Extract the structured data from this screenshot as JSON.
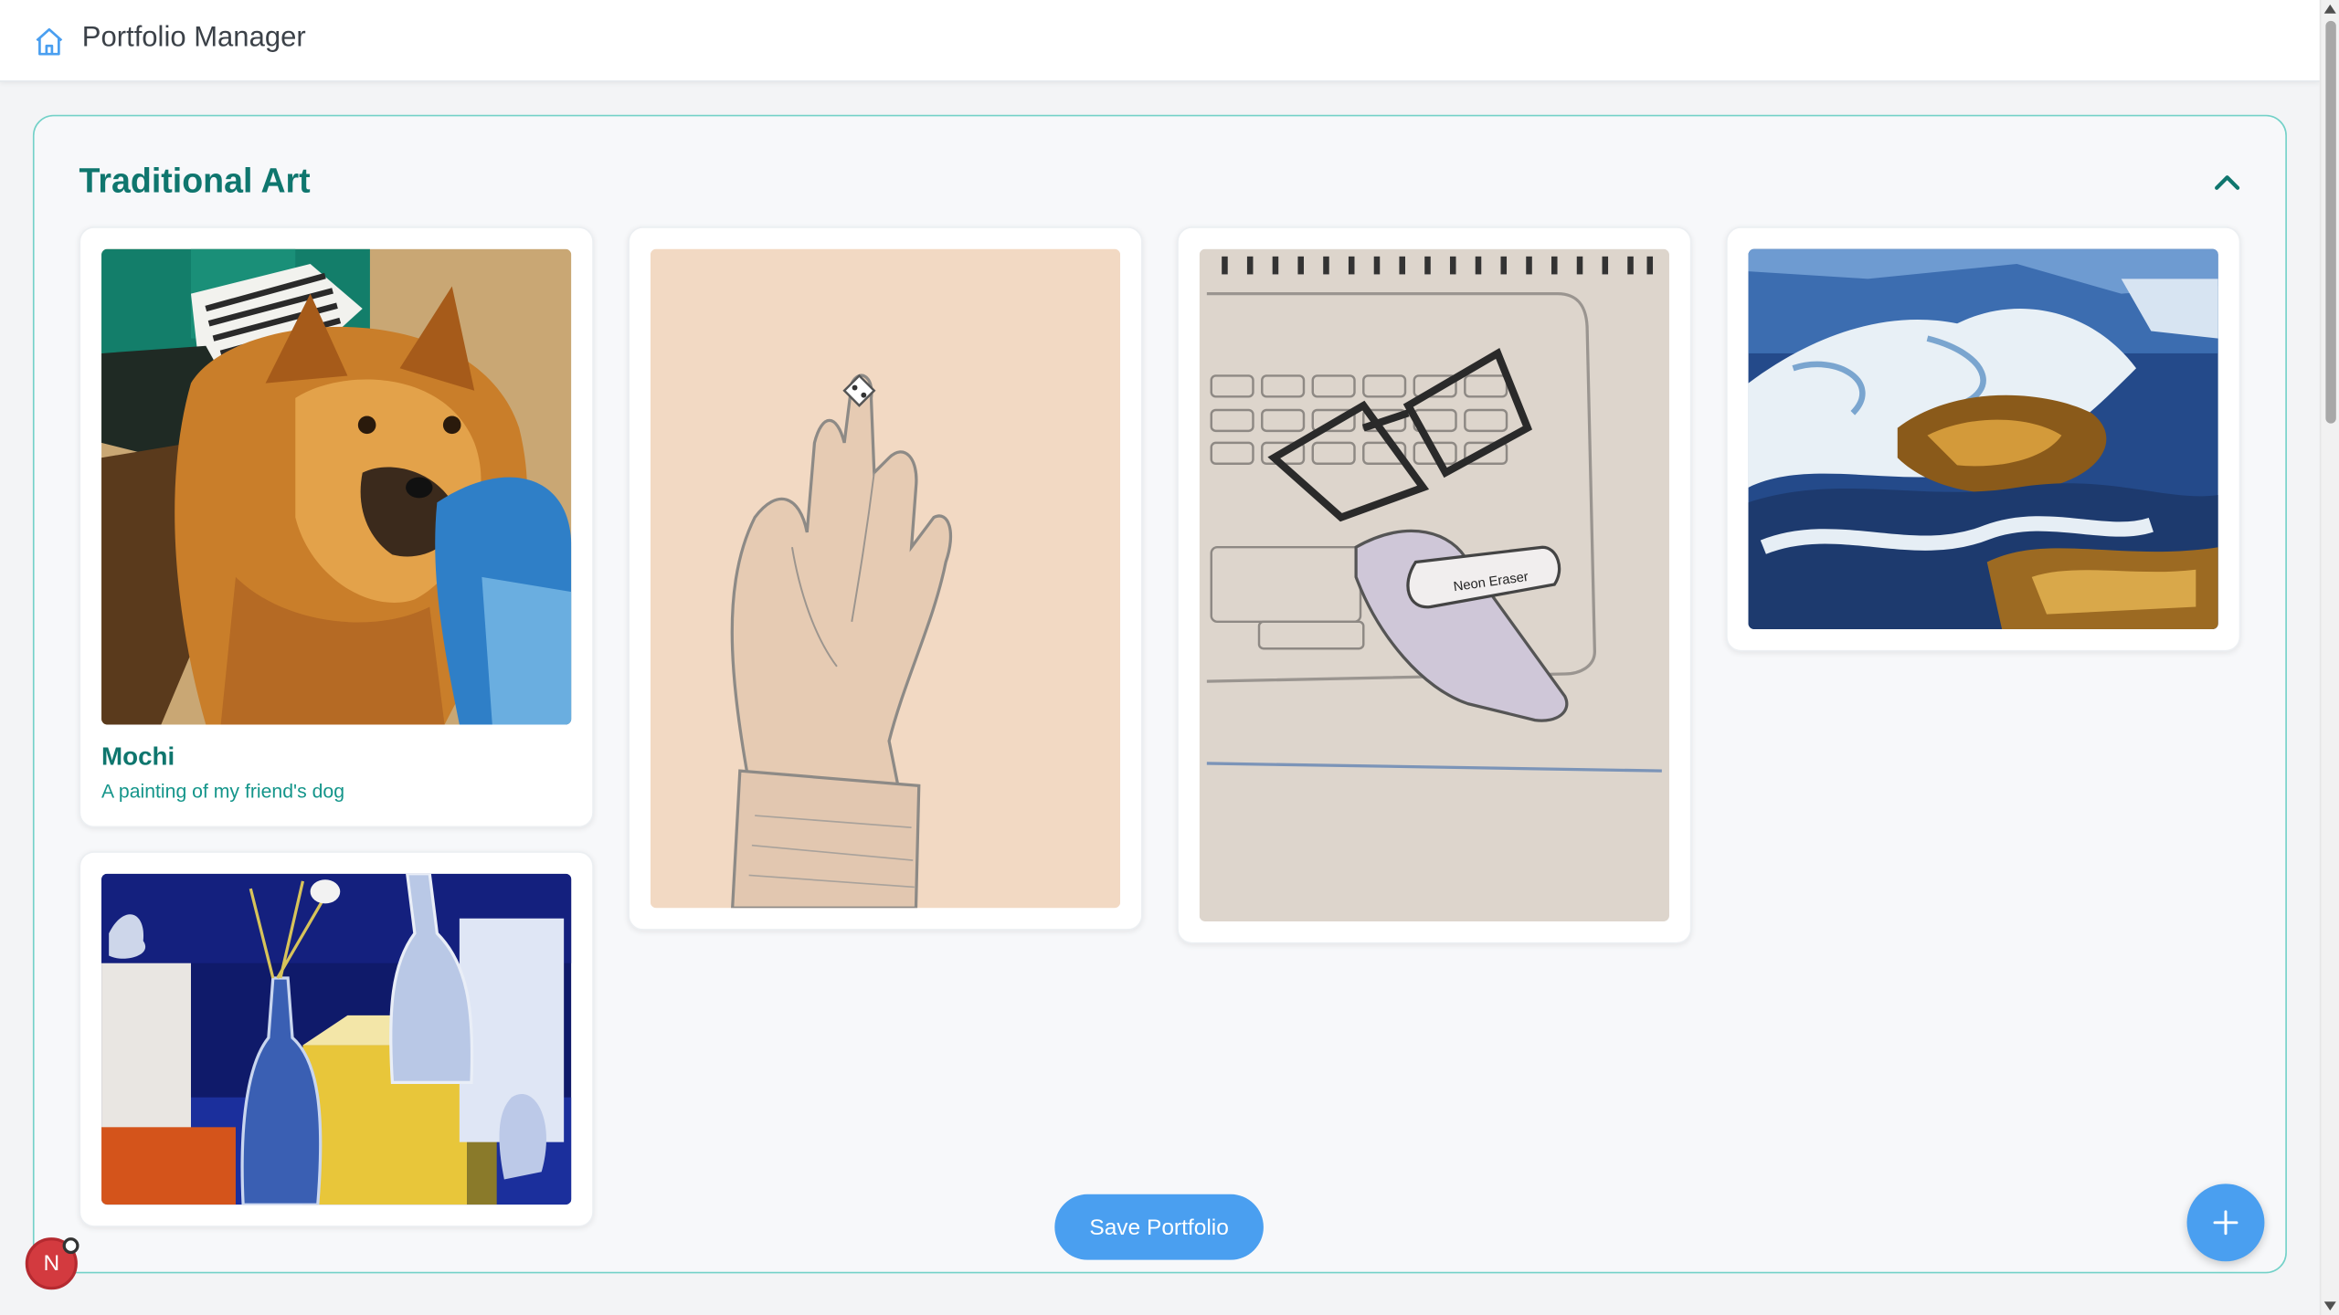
{
  "header": {
    "title": "Portfolio Manager",
    "icon": "home-icon"
  },
  "section": {
    "title": "Traditional Art",
    "collapse_icon": "chevron-up-icon"
  },
  "cards": [
    {
      "title": "Mochi",
      "description": "A painting of my friend's dog",
      "image": "dog-painting"
    },
    {
      "title": "",
      "description": "",
      "image": "hand-with-dice-sketch"
    },
    {
      "title": "",
      "description": "",
      "image": "laptop-glasses-eraser-sketch"
    },
    {
      "title": "",
      "description": "",
      "image": "ocean-waves-painting"
    },
    {
      "title": "",
      "description": "",
      "image": "bottles-still-life-painting"
    }
  ],
  "actions": {
    "save_label": "Save Portfolio",
    "add_icon": "plus-icon"
  },
  "user": {
    "avatar_initial": "N"
  },
  "colors": {
    "accent": "#0f766e",
    "primary_button": "#4a9ff0",
    "section_border": "#73d1c8"
  }
}
